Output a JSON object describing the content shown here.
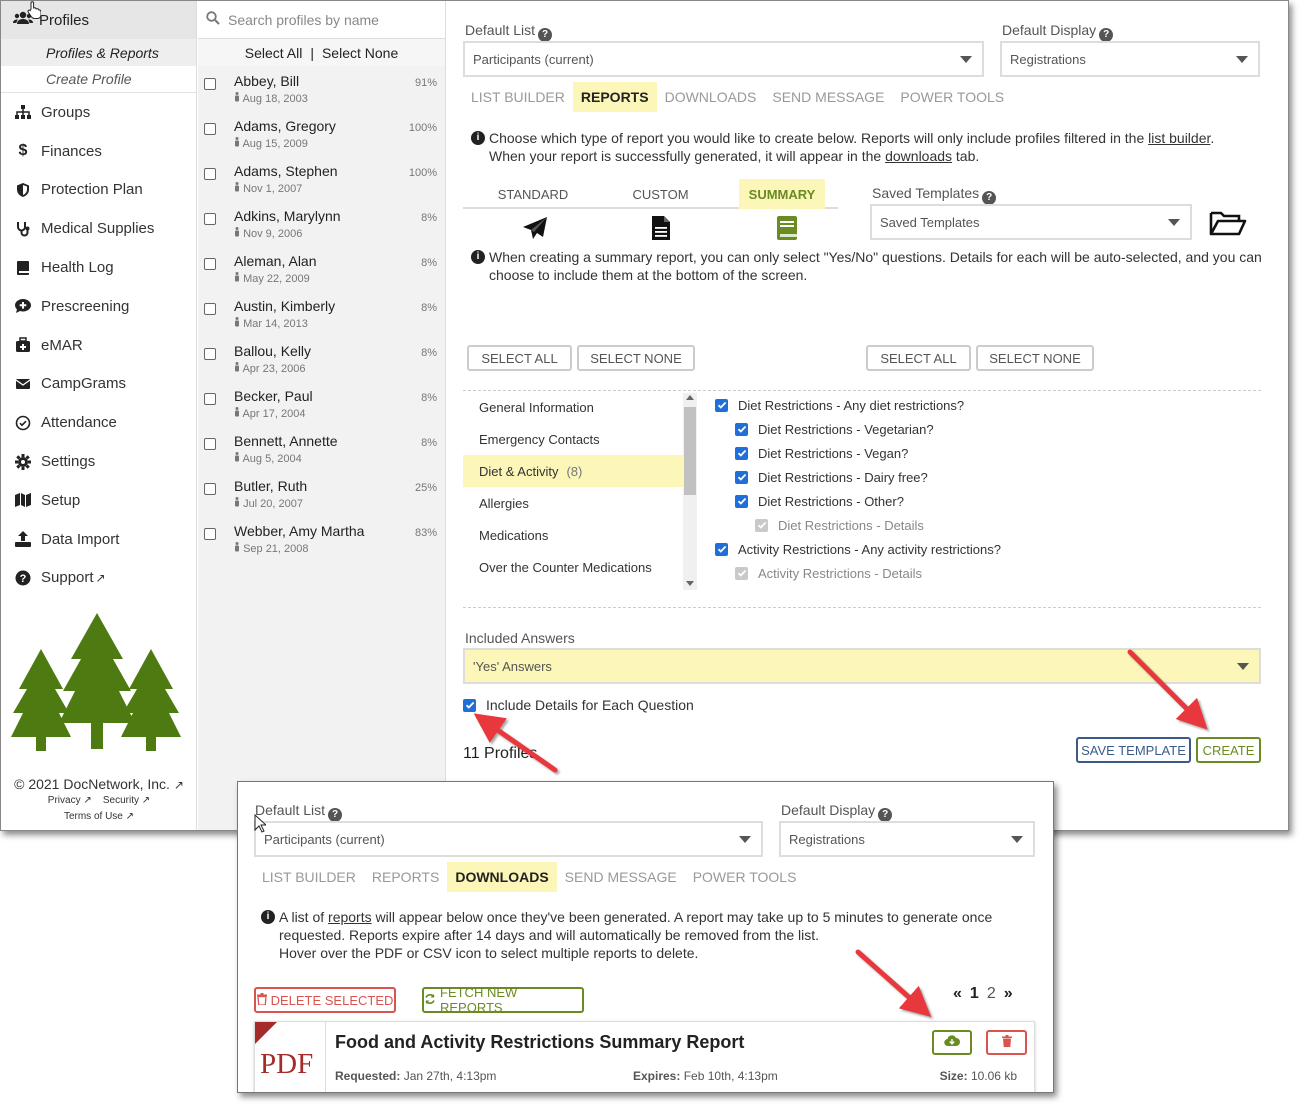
{
  "sidebar": {
    "header": "Profiles",
    "sub_active": "Profiles & Reports",
    "sub_create": "Create Profile",
    "items": [
      {
        "label": "Groups",
        "icon": "sitemap-icon"
      },
      {
        "label": "Finances",
        "icon": "dollar-icon"
      },
      {
        "label": "Protection Plan",
        "icon": "shield-icon"
      },
      {
        "label": "Medical Supplies",
        "icon": "stethoscope-icon"
      },
      {
        "label": "Health Log",
        "icon": "book-icon"
      },
      {
        "label": "Prescreening",
        "icon": "comment-medical-icon"
      },
      {
        "label": "eMAR",
        "icon": "medkit-icon"
      },
      {
        "label": "CampGrams",
        "icon": "envelope-icon"
      },
      {
        "label": "Attendance",
        "icon": "check-circle-icon"
      },
      {
        "label": "Settings",
        "icon": "gear-icon"
      },
      {
        "label": "Setup",
        "icon": "map-icon"
      },
      {
        "label": "Data Import",
        "icon": "upload-icon"
      },
      {
        "label": "Support",
        "icon": "question-circle-icon"
      }
    ],
    "copyright": "© 2021 DocNetwork, Inc.",
    "privacy": "Privacy",
    "security": "Security",
    "terms": "Terms of Use"
  },
  "profiles": {
    "search_placeholder": "Search profiles by name",
    "select_all": "Select All",
    "divider": "|",
    "select_none": "Select None",
    "rows": [
      {
        "name": "Abbey, Bill",
        "date": "Aug 18, 2003",
        "pct": "91%"
      },
      {
        "name": "Adams, Gregory",
        "date": "Aug 15, 2009",
        "pct": "100%"
      },
      {
        "name": "Adams, Stephen",
        "date": "Nov 1, 2007",
        "pct": "100%"
      },
      {
        "name": "Adkins, Marylynn",
        "date": "Nov 9, 2006",
        "pct": "8%"
      },
      {
        "name": "Aleman, Alan",
        "date": "May 22, 2009",
        "pct": "8%"
      },
      {
        "name": "Austin, Kimberly",
        "date": "Mar 14, 2013",
        "pct": "8%"
      },
      {
        "name": "Ballou, Kelly",
        "date": "Apr 23, 2006",
        "pct": "8%"
      },
      {
        "name": "Becker, Paul",
        "date": "Apr 17, 2004",
        "pct": "8%"
      },
      {
        "name": "Bennett, Annette",
        "date": "Aug 5, 2004",
        "pct": "8%"
      },
      {
        "name": "Butler, Ruth",
        "date": "Jul 20, 2007",
        "pct": "25%"
      },
      {
        "name": "Webber, Amy Martha",
        "date": "Sep 21, 2008",
        "pct": "83%"
      }
    ]
  },
  "main": {
    "default_list_label": "Default List",
    "default_list_value": "Participants (current)",
    "default_display_label": "Default Display",
    "default_display_value": "Registrations",
    "tabs": [
      "LIST BUILDER",
      "REPORTS",
      "DOWNLOADS",
      "SEND MESSAGE",
      "POWER TOOLS"
    ],
    "info1_a": "Choose which type of report you would like to create below. Reports will only include profiles filtered in the",
    "info1_link1": "list builder",
    "info1_b": ".",
    "info1_c": "When your report is successfully generated, it will appear in the",
    "info1_link2": "downloads",
    "info1_d": "tab.",
    "report_tabs": [
      "STANDARD",
      "CUSTOM",
      "SUMMARY"
    ],
    "saved_templates_label": "Saved Templates",
    "saved_templates_value": "Saved Templates",
    "info2": "When creating a summary report, you can only select \"Yes/No\" questions. Details for each will be auto-selected, and you can choose to include them at the bottom of the screen.",
    "select_all": "SELECT ALL",
    "select_none": "SELECT NONE",
    "categories": [
      {
        "label": "General Information",
        "count": ""
      },
      {
        "label": "Emergency Contacts",
        "count": ""
      },
      {
        "label": "Diet & Activity",
        "count": "(8)"
      },
      {
        "label": "Allergies",
        "count": ""
      },
      {
        "label": "Medications",
        "count": ""
      },
      {
        "label": "Over the Counter Medications",
        "count": ""
      }
    ],
    "questions": [
      {
        "label": "Diet Restrictions - Any diet restrictions?",
        "level": 0,
        "disabled": false
      },
      {
        "label": "Diet Restrictions - Vegetarian?",
        "level": 1,
        "disabled": false
      },
      {
        "label": "Diet Restrictions - Vegan?",
        "level": 1,
        "disabled": false
      },
      {
        "label": "Diet Restrictions - Dairy free?",
        "level": 1,
        "disabled": false
      },
      {
        "label": "Diet Restrictions - Other?",
        "level": 1,
        "disabled": false
      },
      {
        "label": "Diet Restrictions - Details",
        "level": 2,
        "disabled": true
      },
      {
        "label": "Activity Restrictions - Any activity restrictions?",
        "level": 0,
        "disabled": false
      },
      {
        "label": "Activity Restrictions - Details",
        "level": 1,
        "disabled": true
      }
    ],
    "included_answers_label": "Included Answers",
    "included_answers_value": "'Yes' Answers",
    "include_details_label": "Include Details for Each Question",
    "profiles_count": "11 Profiles",
    "save_template": "SAVE TEMPLATE",
    "create": "CREATE"
  },
  "downloads": {
    "default_list_label": "Default List",
    "default_list_value": "Participants (current)",
    "default_display_label": "Default Display",
    "default_display_value": "Registrations",
    "tabs": [
      "LIST BUILDER",
      "REPORTS",
      "DOWNLOADS",
      "SEND MESSAGE",
      "POWER TOOLS"
    ],
    "info_a": "A list of",
    "info_link": "reports",
    "info_b": "will appear below once they've been generated. A report may take up to 5 minutes to generate once requested. Reports expire after 14 days and will automatically be removed from the list.",
    "info_c": "Hover over the PDF or CSV icon to select multiple reports to delete.",
    "delete_selected": "DELETE SELECTED",
    "fetch_new": "FETCH NEW REPORTS",
    "pages": [
      "1",
      "2"
    ],
    "report_title": "Food and Activity Restrictions Summary Report",
    "file_type": "PDF",
    "requested_label": "Requested:",
    "requested_value": "Jan 27th, 4:13pm",
    "expires_label": "Expires:",
    "expires_value": "Feb 10th, 4:13pm",
    "size_label": "Size:",
    "size_value": "10.06 kb"
  },
  "colors": {
    "highlight": "#fcf6b8",
    "green": "#6a8b22",
    "red": "#d9534f",
    "blue": "#1e6fd9",
    "arrow": "#e8383d",
    "tree": "#4e7a12"
  }
}
